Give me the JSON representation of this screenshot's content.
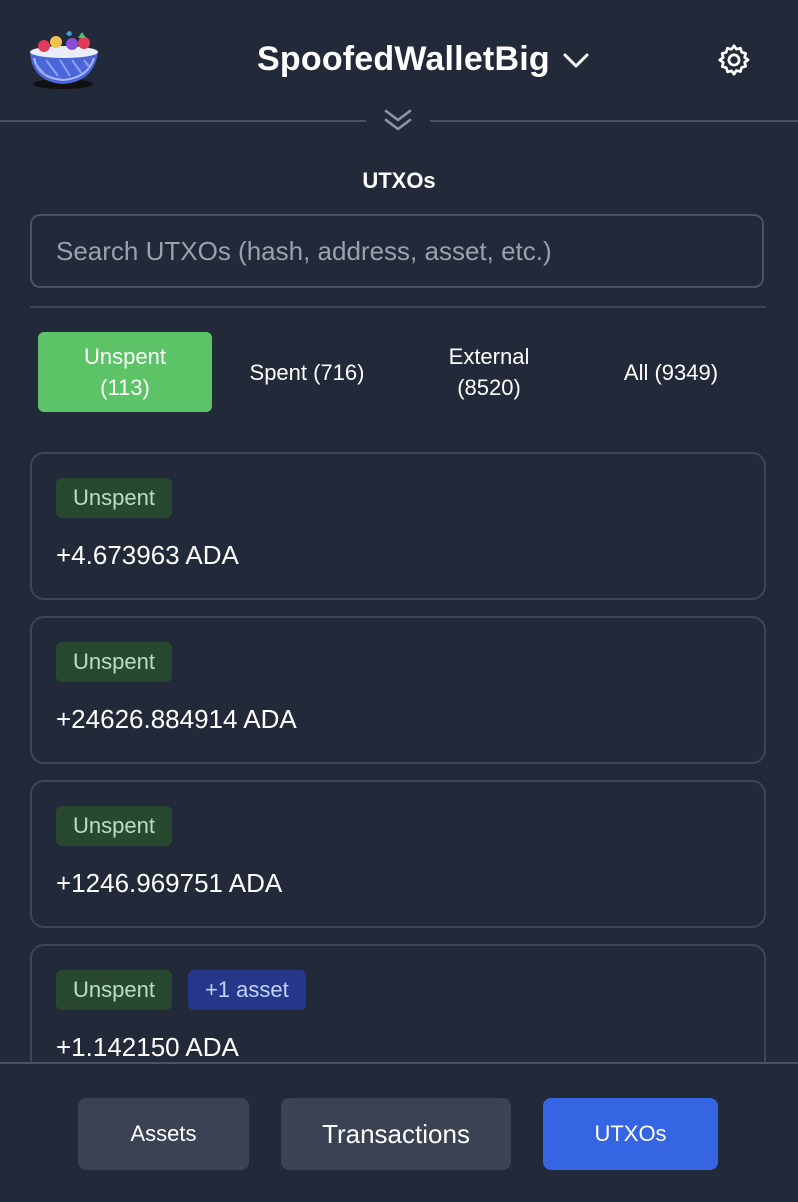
{
  "header": {
    "wallet_name": "SpoofedWalletBig",
    "icons": [
      "cereal-bowl-logo-icon",
      "chevron-down-icon",
      "gear-icon",
      "double-chevron-down-icon"
    ]
  },
  "utxos": {
    "title": "UTXOs",
    "search_placeholder": "Search UTXOs (hash, address, asset, etc.)",
    "search_value": "",
    "filters": [
      {
        "label": "Unspent\n(113)",
        "active": true
      },
      {
        "label": "Spent (716)",
        "active": false
      },
      {
        "label": "External\n(8520)",
        "active": false
      },
      {
        "label": "All (9349)",
        "active": false
      }
    ],
    "items": [
      {
        "status": "Unspent",
        "amount": "+4.673963 ADA"
      },
      {
        "status": "Unspent",
        "amount": "+24626.884914 ADA"
      },
      {
        "status": "Unspent",
        "amount": "+1246.969751 ADA"
      },
      {
        "status": "Unspent",
        "extra": "+1 asset",
        "amount": "+1.142150 ADA"
      }
    ]
  },
  "footer": {
    "nav": [
      {
        "label": "Assets",
        "active": false
      },
      {
        "label": "Transactions",
        "active": false
      },
      {
        "label": "UTXOs",
        "active": true
      }
    ]
  },
  "colors": {
    "background": "#222938",
    "active_filter": "#5cc466",
    "active_nav": "#3565e3",
    "unspent_badge": "#28492f",
    "asset_badge": "#26388a"
  }
}
